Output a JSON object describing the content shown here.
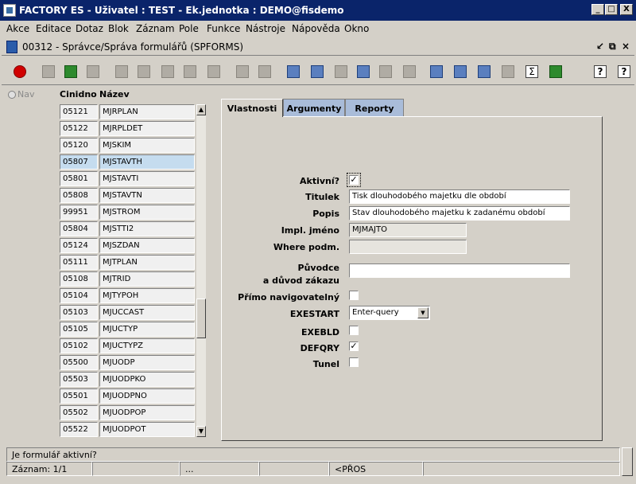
{
  "titlebar": {
    "title": "FACTORY ES - Uživatel : TEST - Ek.jednotka : DEMO@fisdemo",
    "minimize": "_",
    "maximize": "□",
    "close": "X"
  },
  "menu": [
    "Akce",
    "Editace",
    "Dotaz",
    "Blok",
    "Záznam",
    "Pole",
    "Funkce",
    "Nástroje",
    "Nápověda",
    "Okno"
  ],
  "subwindow": {
    "title": "00312 - Správce/Správa formulářů (SPFORMS)",
    "minimize": "↙",
    "restore": "⧉",
    "close": "×"
  },
  "toolbar_icons": [
    "exit-icon",
    "cut-record-icon",
    "home-icon",
    "cancel-icon",
    "query-icon",
    "execute-query-icon",
    "sort-asc-icon",
    "sort-desc-icon",
    "sort-multi-icon",
    "print-icon",
    "print-preview-icon",
    "scissors-icon",
    "copy-icon",
    "paste-icon",
    "search-icon",
    "align-left-icon",
    "align-right-icon",
    "calculator-icon",
    "settings-wheel-icon",
    "chart-icon",
    "calendar-icon",
    "sum-icon",
    "excel-icon",
    "help-icon",
    "context-help-icon"
  ],
  "nav_label": "Nav",
  "columns": {
    "c1": "Cinidno",
    "c2": "Název"
  },
  "rows": [
    {
      "c1": "05121",
      "c2": "MJRPLAN"
    },
    {
      "c1": "05122",
      "c2": "MJRPLDET"
    },
    {
      "c1": "05120",
      "c2": "MJSKIM"
    },
    {
      "c1": "05807",
      "c2": "MJSTAVTH"
    },
    {
      "c1": "05801",
      "c2": "MJSTAVTI"
    },
    {
      "c1": "05808",
      "c2": "MJSTAVTN"
    },
    {
      "c1": "99951",
      "c2": "MJSTROM"
    },
    {
      "c1": "05804",
      "c2": "MJSTTI2"
    },
    {
      "c1": "05124",
      "c2": "MJSZDAN"
    },
    {
      "c1": "05111",
      "c2": "MJTPLAN"
    },
    {
      "c1": "05108",
      "c2": "MJTRID"
    },
    {
      "c1": "05104",
      "c2": "MJTYPOH"
    },
    {
      "c1": "05103",
      "c2": "MJUCCAST"
    },
    {
      "c1": "05105",
      "c2": "MJUCTYP"
    },
    {
      "c1": "05102",
      "c2": "MJUCTYPZ"
    },
    {
      "c1": "05500",
      "c2": "MJUODP"
    },
    {
      "c1": "05503",
      "c2": "MJUODPKO"
    },
    {
      "c1": "05501",
      "c2": "MJUODPNO"
    },
    {
      "c1": "05502",
      "c2": "MJUODPOP"
    },
    {
      "c1": "05522",
      "c2": "MJUODPOT"
    }
  ],
  "selected_row": 3,
  "tabs": [
    "Vlastnosti",
    "Argumenty",
    "Reporty"
  ],
  "form": {
    "aktivni_label": "Aktivní?",
    "aktivni_checked": true,
    "titulek_label": "Titulek",
    "titulek_value": "Tisk dlouhodobého majetku dle období",
    "popis_label": "Popis",
    "popis_value": "Stav dlouhodobého majetku k zadanému období",
    "impl_label": "Impl. jméno",
    "impl_value": "MJMAJTO",
    "where_label": "Where podm.",
    "where_value": "",
    "puvodce_label1": "Původce",
    "puvodce_label2": "a důvod zákazu",
    "puvodce_value": "",
    "primo_label": "Přímo navigovatelný",
    "primo_checked": false,
    "exestart_label": "EXESTART",
    "exestart_value": "Enter-query",
    "exebld_label": "EXEBLD",
    "exebld_checked": false,
    "defqry_label": "DEFQRY",
    "defqry_checked": true,
    "tunel_label": "Tunel",
    "tunel_checked": false
  },
  "status": {
    "message": "Je formulář aktivní?",
    "record": "Záznam: 1/1",
    "seg2": "",
    "seg3": "...",
    "seg4": "",
    "mode": "<PŘOS",
    "seg6": ""
  }
}
